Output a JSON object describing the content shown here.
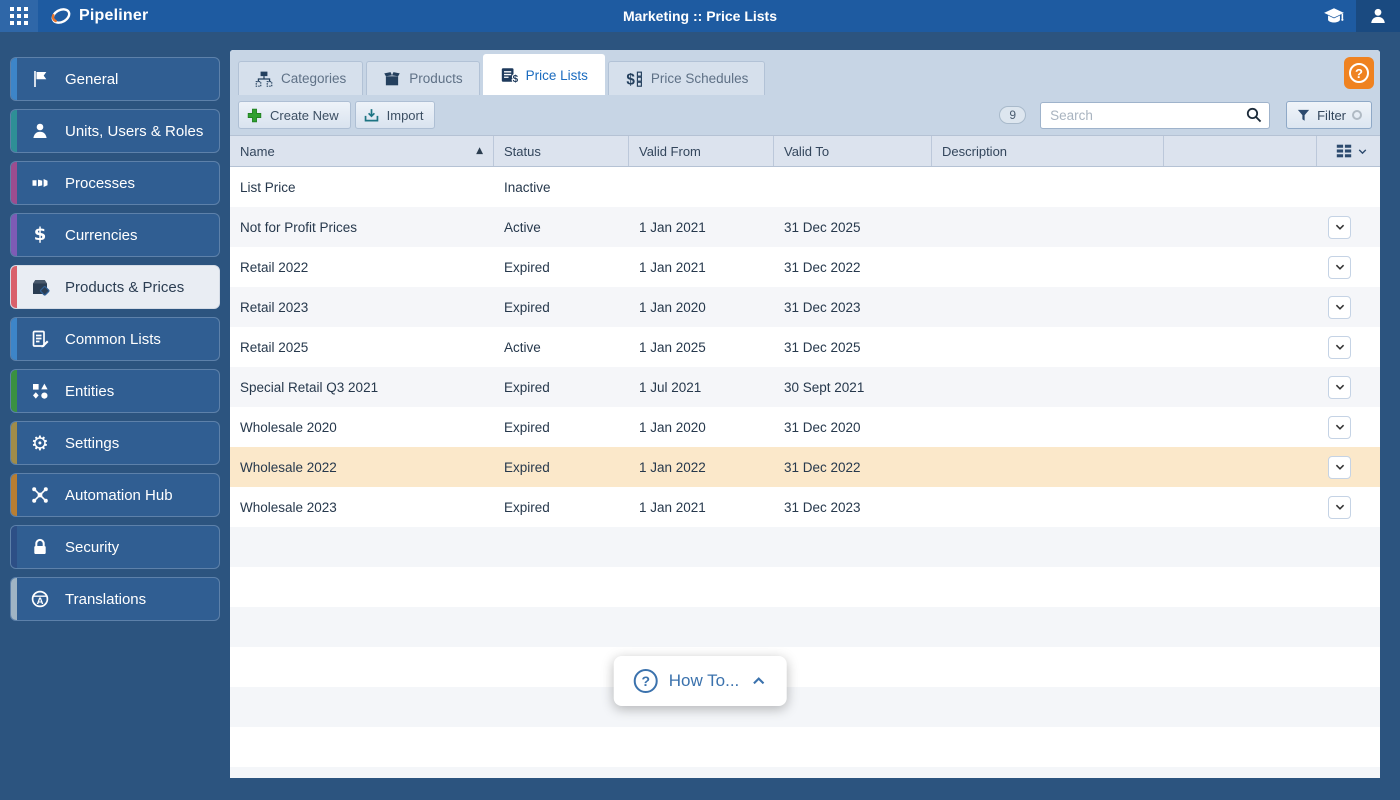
{
  "topbar": {
    "app_title": "Pipeliner",
    "page_title": "Marketing :: Price Lists"
  },
  "sidebar": {
    "items": [
      {
        "label": "General",
        "icon": "flag-icon",
        "stripe": "#3d85c8",
        "active": false
      },
      {
        "label": "Units, Users & Roles",
        "icon": "user-icon",
        "stripe": "#2e8f96",
        "active": false
      },
      {
        "label": "Processes",
        "icon": "pipeline-icon",
        "stripe": "#9c4d8f",
        "active": false
      },
      {
        "label": "Currencies",
        "icon": "dollar-icon",
        "stripe": "#7e5bb5",
        "active": false
      },
      {
        "label": "Products & Prices",
        "icon": "box-tag-icon",
        "stripe": "#d9606b",
        "active": true
      },
      {
        "label": "Common Lists",
        "icon": "document-edit-icon",
        "stripe": "#3d85c8",
        "active": false
      },
      {
        "label": "Entities",
        "icon": "shapes-icon",
        "stripe": "#3a9141",
        "active": false
      },
      {
        "label": "Settings",
        "icon": "gear-icon",
        "stripe": "#a08c4a",
        "active": false
      },
      {
        "label": "Automation Hub",
        "icon": "network-icon",
        "stripe": "#b87e33",
        "active": false
      },
      {
        "label": "Security",
        "icon": "lock-icon",
        "stripe": "#2d4f86",
        "active": false
      },
      {
        "label": "Translations",
        "icon": "globe-icon",
        "stripe": "#9fb4c4",
        "active": false
      }
    ]
  },
  "tabs": [
    {
      "label": "Categories",
      "icon": "hierarchy-icon",
      "active": false
    },
    {
      "label": "Products",
      "icon": "box-icon",
      "active": false
    },
    {
      "label": "Price Lists",
      "icon": "price-list-icon",
      "active": true
    },
    {
      "label": "Price Schedules",
      "icon": "price-schedule-icon",
      "active": false
    }
  ],
  "toolbar": {
    "create_new_label": "Create New",
    "import_label": "Import",
    "count_badge": "9",
    "search_placeholder": "Search",
    "filter_label": "Filter"
  },
  "table": {
    "columns": [
      "Name",
      "Status",
      "Valid From",
      "Valid To",
      "Description"
    ],
    "sort_column": "Name",
    "sort_direction": "asc",
    "rows": [
      {
        "name": "List Price",
        "status": "Inactive",
        "valid_from": "",
        "valid_to": "",
        "description": "",
        "has_menu": false,
        "highlight": false
      },
      {
        "name": "Not for Profit Prices",
        "status": "Active",
        "valid_from": "1 Jan 2021",
        "valid_to": "31 Dec 2025",
        "description": "",
        "has_menu": true,
        "highlight": false
      },
      {
        "name": "Retail 2022",
        "status": "Expired",
        "valid_from": "1 Jan 2021",
        "valid_to": "31 Dec 2022",
        "description": "",
        "has_menu": true,
        "highlight": false
      },
      {
        "name": "Retail 2023",
        "status": "Expired",
        "valid_from": "1 Jan 2020",
        "valid_to": "31 Dec 2023",
        "description": "",
        "has_menu": true,
        "highlight": false
      },
      {
        "name": "Retail 2025",
        "status": "Active",
        "valid_from": "1 Jan 2025",
        "valid_to": "31 Dec 2025",
        "description": "",
        "has_menu": true,
        "highlight": false
      },
      {
        "name": "Special Retail Q3 2021",
        "status": "Expired",
        "valid_from": "1 Jul 2021",
        "valid_to": "30 Sept 2021",
        "description": "",
        "has_menu": true,
        "highlight": false
      },
      {
        "name": "Wholesale 2020",
        "status": "Expired",
        "valid_from": "1 Jan 2020",
        "valid_to": "31 Dec 2020",
        "description": "",
        "has_menu": true,
        "highlight": false
      },
      {
        "name": "Wholesale 2022",
        "status": "Expired",
        "valid_from": "1 Jan 2022",
        "valid_to": "31 Dec 2022",
        "description": "",
        "has_menu": true,
        "highlight": true
      },
      {
        "name": "Wholesale 2023",
        "status": "Expired",
        "valid_from": "1 Jan 2021",
        "valid_to": "31 Dec 2023",
        "description": "",
        "has_menu": true,
        "highlight": false
      }
    ]
  },
  "footer": {
    "how_to_label": "How To..."
  },
  "colors": {
    "topbar": "#1e5ba1",
    "page_background": "#2c547f",
    "highlight_row": "#fbe8ca",
    "help_button": "#ef8220",
    "active_tab_text": "#1a6bbf",
    "create_plus": "#30a030",
    "import_icon": "#1d7483"
  }
}
